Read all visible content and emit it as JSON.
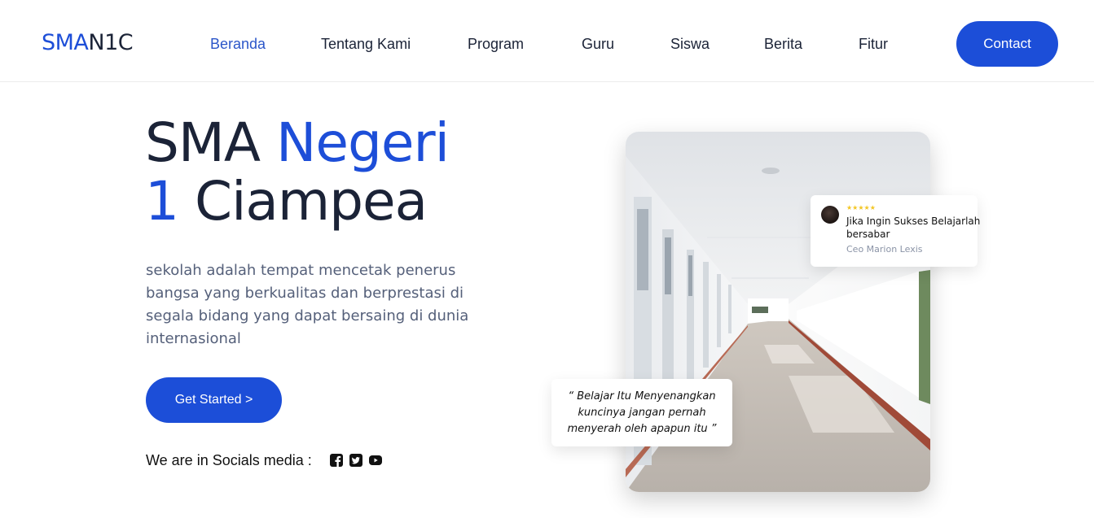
{
  "nav": {
    "logo_part1": "SMA",
    "logo_part2": "N1C",
    "links": [
      {
        "label": "Beranda"
      },
      {
        "label": "Tentang Kami"
      },
      {
        "label": "Program"
      },
      {
        "label": "Guru"
      },
      {
        "label": "Siswa"
      },
      {
        "label": "Berita"
      },
      {
        "label": "Fitur"
      }
    ],
    "contact_label": "Contact"
  },
  "hero": {
    "title_part1": "SMA ",
    "title_part2": "Negeri",
    "title_part3": "1",
    "title_part4": " Ciampea",
    "description": "sekolah adalah tempat mencetak penerus bangsa yang berkualitas dan berprestasi di segala bidang yang dapat bersaing di dunia internasional",
    "cta_label": "Get Started >",
    "socials_label": "We are in Socials media :",
    "social_icons": [
      "facebook-icon",
      "twitter-icon",
      "youtube-icon"
    ]
  },
  "testimonial": {
    "rating": 5,
    "stars": "★★★★★",
    "quote": "Jika Ingin Sukses Belajarlah bersabar",
    "author": "Ceo Marion Lexis"
  },
  "quote_card": {
    "text": "“ Belajar Itu Menyenangkan kuncinya jangan pernah menyerah oleh apapun itu ”"
  },
  "colors": {
    "accent": "#1d4ed8",
    "text": "#1b2337",
    "muted": "#55607a",
    "star": "#f3c623"
  }
}
